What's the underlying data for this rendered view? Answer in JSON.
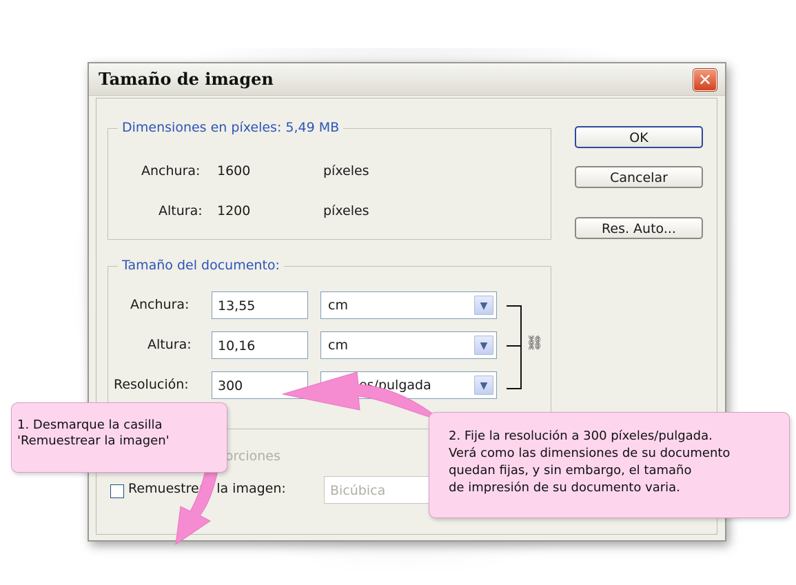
{
  "dialog": {
    "title": "Tamaño de imagen",
    "close_icon": "close-icon"
  },
  "pixel_dimensions": {
    "legend": "Dimensiones en píxeles: 5,49 MB",
    "width_label": "Anchura:",
    "width_value": "1600",
    "width_unit": "píxeles",
    "height_label": "Altura:",
    "height_value": "1200",
    "height_unit": "píxeles"
  },
  "document_size": {
    "legend": "Tamaño del documento:",
    "width_label": "Anchura:",
    "width_value": "13,55",
    "width_unit": "cm",
    "height_label": "Altura:",
    "height_value": "10,16",
    "height_unit": "cm",
    "resolution_label": "Resolución:",
    "resolution_value": "300",
    "resolution_unit": "píxeles/pulgada"
  },
  "options": {
    "constrain_label": "Restringir proporciones",
    "resample_label": "Remuestrear la imagen:",
    "resample_checked": false,
    "resample_method": "Bicúbica"
  },
  "buttons": {
    "ok": "OK",
    "cancel": "Cancelar",
    "auto": "Res. Auto..."
  },
  "callouts": {
    "left": {
      "lines": [
        "1. Desmarque la casilla",
        "'Remuestrear la imagen'"
      ]
    },
    "right": {
      "lines": [
        "2. Fije la resolución a 300 píxeles/pulgada.",
        "Verá como las dimensiones de su documento",
        "quedan fijas, y sin embargo, el tamaño",
        "de impresión de su documento varia."
      ]
    }
  },
  "colors": {
    "legend_blue": "#2d55b8",
    "callout_pink": "#fdd6ee",
    "arrow_pink": "#f58bd0",
    "close_red": "#d2421f"
  }
}
